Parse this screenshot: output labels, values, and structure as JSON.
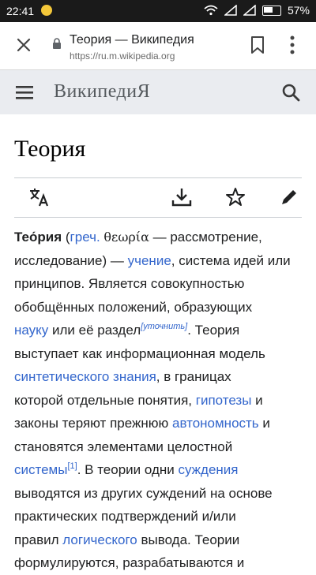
{
  "status_bar": {
    "time": "22:41",
    "battery": "57%"
  },
  "browser": {
    "title": "Теория — Википедия",
    "url": "https://ru.m.wikipedia.org"
  },
  "wiki": {
    "wordmark": "ВикипедиЯ"
  },
  "article": {
    "title": "Теория",
    "paragraph": {
      "term": "Тео́рия",
      "p1_open": "(",
      "greek_link": "греч.",
      "greek": "θεωρία",
      "p1_rest": " — рассмотрение,",
      "p2_a": "исследование) — ",
      "link_uchenie": "учение",
      "p2_b": ", система идей или",
      "p3": "принципов. Является совокупностью",
      "p4": "обобщённых положений, образующих",
      "link_nauku": "науку",
      "p5_b": " или её раздел",
      "sup_clarify": "[уточнить]",
      "p5_c": ". Теория",
      "p6": "выступает как информационная модель",
      "link_synth": "синтетического знания",
      "p7_b": ", в границах",
      "p8_a": "которой отдельные понятия, ",
      "link_hyp": "гипотезы",
      "p8_b": " и",
      "p9_a": "законы теряют прежнюю ",
      "link_auto": "автономность",
      "p9_b": " и",
      "p10": "становятся элементами целостной",
      "link_systems": "системы",
      "sup_ref": "[1]",
      "p11_b": ". В теории одни ",
      "link_judg": "суждения",
      "p12": "выводятся из других суждений на основе",
      "p13": "практических подтверждений и/или",
      "p14_a": "правил ",
      "link_logic": "логического",
      "p14_b": " вывода. Теории",
      "p15": "формулируются, разрабатываются и"
    }
  },
  "icons": {
    "close": "close-icon",
    "lock": "lock-icon",
    "bookmark": "bookmark-icon",
    "menu": "more-vert-icon",
    "hamburger": "hamburger-icon",
    "search": "search-icon",
    "language": "language-icon",
    "download": "download-icon",
    "star": "star-icon",
    "edit": "pencil-icon"
  },
  "colors": {
    "link": "#3366cc",
    "header_bg": "#eaecf0",
    "statusbar_bg": "#1a1a1a"
  }
}
